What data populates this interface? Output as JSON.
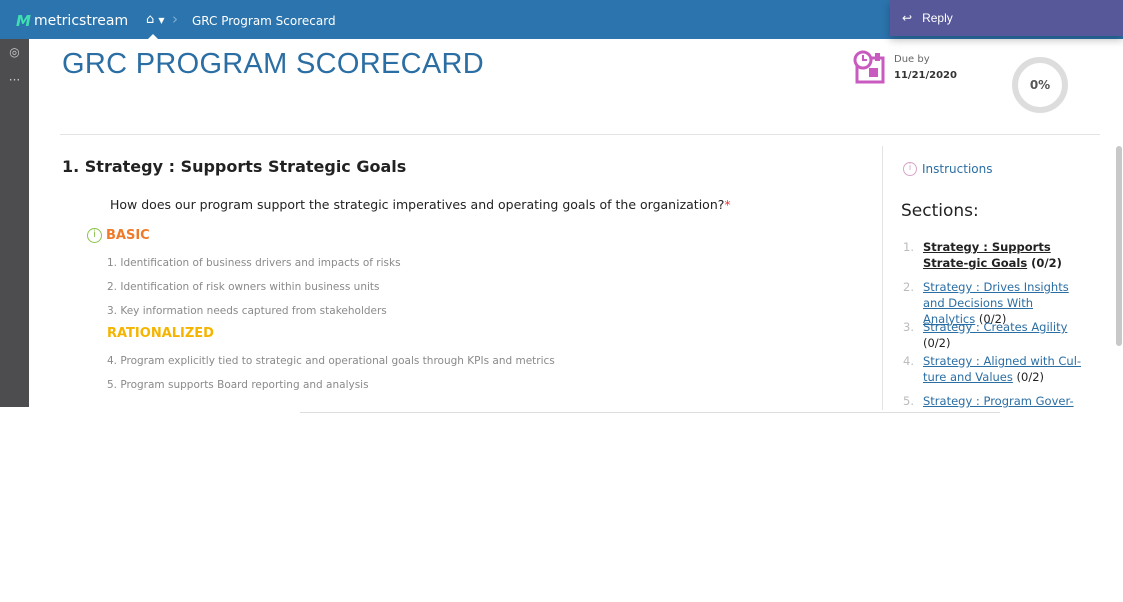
{
  "app": {
    "logo": "metricstream",
    "breadcrumb": "GRC Program Scorecard"
  },
  "reply": {
    "label": "Reply"
  },
  "page": {
    "title": "GRC PROGRAM SCORECARD",
    "due_label": "Due by",
    "due_date": "11/21/2020",
    "progress": "0%",
    "progress_value": 0
  },
  "section": {
    "title": "1.  Strategy : Supports Strategic Goals",
    "question": "How does our program support the strategic imperatives and operating goals of the organization?",
    "required": "*",
    "levels": [
      {
        "name": "BASIC",
        "color": "#f07a2a",
        "items": [
          "1. Identification of business drivers and impacts of risks",
          "2. Identification of risk owners within business units",
          "3. Key information needs captured from stakeholders"
        ]
      },
      {
        "name": "RATIONALIZED",
        "color": "#f5b400",
        "items": [
          "4. Program explicitly tied to strategic and operational goals through KPIs and metrics",
          "5. Program supports Board reporting and analysis"
        ]
      }
    ]
  },
  "sidebar": {
    "instructions": "Instructions",
    "heading": "Sections:",
    "sections": [
      {
        "num": "1.",
        "label": "Strategy : Supports Strate-gic Goals",
        "count": " (0/2)"
      },
      {
        "num": "2.",
        "label": "Strategy : Drives Insights and Decisions With Analytics",
        "count": " (0/2)"
      },
      {
        "num": "3.",
        "label": "Strategy : Creates Agility",
        "count": " (0/2)"
      },
      {
        "num": "4.",
        "label": "Strategy : Aligned with Cul-ture and Values",
        "count": " (0/2)"
      },
      {
        "num": "5.",
        "label": "Strategy : Program Gover-",
        "count": ""
      }
    ]
  }
}
